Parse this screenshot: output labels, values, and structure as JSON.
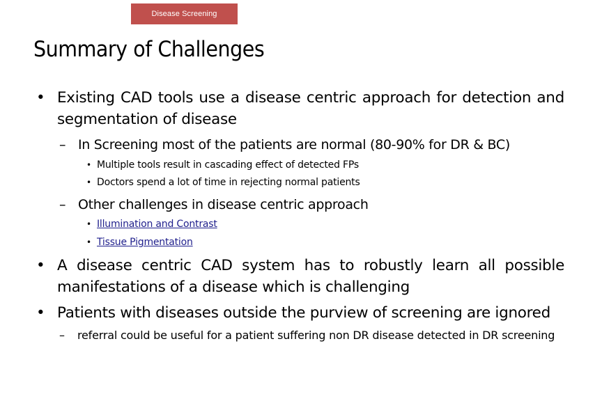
{
  "header_tag": {
    "label": "Disease Screening",
    "color": "#c0504d"
  },
  "slide": {
    "title": "Summary of Challenges",
    "bullets": [
      {
        "icon": "bullet-icon",
        "text": "Existing CAD tools use a disease centric approach for detection and segmentation of disease",
        "sub": [
          {
            "icon": "dash-icon",
            "text": "In Screening most of the patients are normal (80-90% for DR & BC)",
            "sub": [
              {
                "icon": "bullet-icon",
                "text": "Multiple tools result in cascading effect of detected FPs"
              },
              {
                "icon": "bullet-icon",
                "text": "Doctors spend a lot of time in rejecting normal patients"
              }
            ]
          },
          {
            "icon": "dash-icon",
            "text": "Other challenges in disease centric approach",
            "sub": [
              {
                "icon": "bullet-icon",
                "text": "Illumination and Contrast",
                "link": true
              },
              {
                "icon": "bullet-icon",
                "text": "Tissue Pigmentation",
                "link": true
              }
            ]
          }
        ]
      },
      {
        "icon": "bullet-icon",
        "text": "A disease centric CAD system has to robustly learn all possible manifestations of a disease which is challenging"
      },
      {
        "icon": "bullet-icon",
        "text": "Patients with diseases outside the purview of screening are ignored",
        "sub": [
          {
            "icon": "dash-icon",
            "text": "referral could be useful for a patient suffering non DR disease detected in DR screening"
          }
        ]
      }
    ],
    "link_color": "#1f1f8c"
  },
  "glyphs": {
    "bullet": "•",
    "dash": "–"
  }
}
